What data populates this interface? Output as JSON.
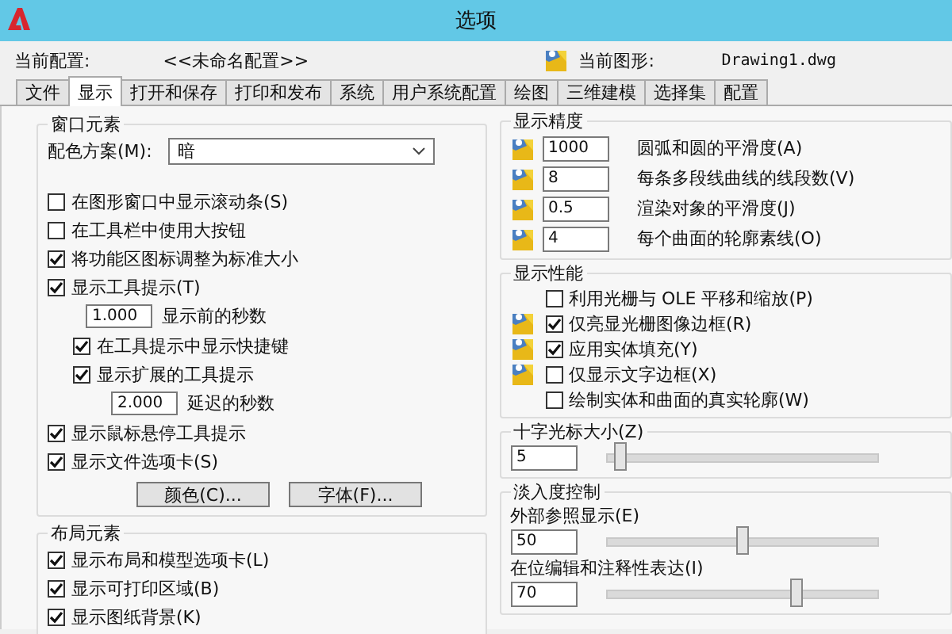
{
  "window": {
    "title": "选项"
  },
  "profile": {
    "label": "当前配置:",
    "value": "<<未命名配置>>",
    "drawing_label": "当前图形:",
    "drawing_value": "Drawing1.dwg"
  },
  "tabs": [
    {
      "label": "文件",
      "selected": false
    },
    {
      "label": "显示",
      "selected": true
    },
    {
      "label": "打开和保存",
      "selected": false
    },
    {
      "label": "打印和发布",
      "selected": false
    },
    {
      "label": "系统",
      "selected": false
    },
    {
      "label": "用户系统配置",
      "selected": false
    },
    {
      "label": "绘图",
      "selected": false
    },
    {
      "label": "三维建模",
      "selected": false
    },
    {
      "label": "选择集",
      "selected": false
    },
    {
      "label": "配置",
      "selected": false
    }
  ],
  "window_elements": {
    "title": "窗口元素",
    "color_scheme": {
      "label": "配色方案(M):",
      "value": "暗"
    },
    "options": [
      {
        "kind": "check",
        "label": "在图形窗口中显示滚动条(S)",
        "checked": false
      },
      {
        "kind": "check",
        "label": "在工具栏中使用大按钮",
        "checked": false
      },
      {
        "kind": "check",
        "label": "将功能区图标调整为标准大小",
        "checked": true
      },
      {
        "kind": "check",
        "label": "显示工具提示(T)",
        "checked": true,
        "children": [
          {
            "kind": "field",
            "value": "1.000",
            "label": "显示前的秒数"
          },
          {
            "kind": "check",
            "label": "在工具提示中显示快捷键",
            "checked": true
          },
          {
            "kind": "check",
            "label": "显示扩展的工具提示",
            "checked": true,
            "children": [
              {
                "kind": "field",
                "value": "2.000",
                "label": "延迟的秒数"
              }
            ]
          }
        ]
      },
      {
        "kind": "check",
        "label": "显示鼠标悬停工具提示",
        "checked": true
      },
      {
        "kind": "check",
        "label": "显示文件选项卡(S)",
        "checked": true
      }
    ],
    "buttons": [
      "颜色(C)...",
      "字体(F)..."
    ]
  },
  "layout_elements": {
    "title": "布局元素",
    "options": [
      {
        "kind": "check",
        "label": "显示布局和模型选项卡(L)",
        "checked": true
      },
      {
        "kind": "check",
        "label": "显示可打印区域(B)",
        "checked": true
      },
      {
        "kind": "check",
        "label": "显示图纸背景(K)",
        "checked": true
      }
    ]
  },
  "display_resolution": {
    "title": "显示精度",
    "rows": [
      {
        "value": "1000",
        "label": "圆弧和圆的平滑度(A)",
        "saved_in_drawing": true
      },
      {
        "value": "8",
        "label": "每条多段线曲线的线段数(V)",
        "saved_in_drawing": true
      },
      {
        "value": "0.5",
        "label": "渲染对象的平滑度(J)",
        "saved_in_drawing": true
      },
      {
        "value": "4",
        "label": "每个曲面的轮廓素线(O)",
        "saved_in_drawing": true
      }
    ]
  },
  "display_performance": {
    "title": "显示性能",
    "items": [
      {
        "label": "利用光栅与 OLE 平移和缩放(P)",
        "checked": false,
        "saved_in_drawing": false
      },
      {
        "label": "仅亮显光栅图像边框(R)",
        "checked": true,
        "saved_in_drawing": true
      },
      {
        "label": "应用实体填充(Y)",
        "checked": true,
        "saved_in_drawing": true
      },
      {
        "label": "仅显示文字边框(X)",
        "checked": false,
        "saved_in_drawing": true
      },
      {
        "label": "绘制实体和曲面的真实轮廓(W)",
        "checked": false,
        "saved_in_drawing": false
      }
    ]
  },
  "crosshair": {
    "title": "十字光标大小(Z)",
    "value": "5",
    "level": 0.05
  },
  "fade_control": {
    "title": "淡入度控制",
    "items": [
      {
        "label": "外部参照显示(E)",
        "value": "50",
        "level": 0.5
      },
      {
        "label": "在位编辑和注释性表达(I)",
        "value": "70",
        "level": 0.7
      }
    ]
  }
}
